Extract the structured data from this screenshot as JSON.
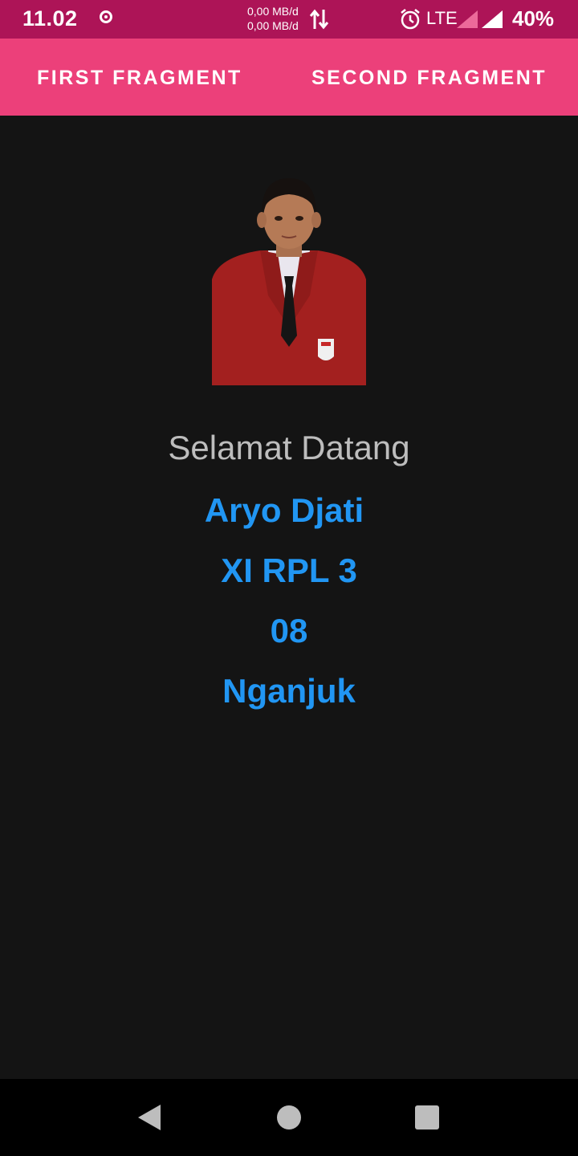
{
  "status_bar": {
    "time": "11.02",
    "net_up": "0,00 MB/d",
    "net_down": "0,00 MB/d",
    "network_type": "LTE",
    "battery": "40%",
    "icons": [
      "record-icon",
      "data-transfer-icon",
      "alarm-icon",
      "signal-icon",
      "signal-icon"
    ]
  },
  "tabs": [
    {
      "label": "FIRST FRAGMENT"
    },
    {
      "label": "SECOND FRAGMENT"
    }
  ],
  "profile": {
    "greeting": "Selamat Datang",
    "name": "Aryo Djati",
    "class": "XI RPL 3",
    "number": "08",
    "city": "Nganjuk"
  },
  "colors": {
    "status_bar": "#ad1457",
    "tab_bar": "#ec407a",
    "background": "#141414",
    "accent_text": "#2196f3",
    "greeting_text": "#bdbdbd"
  },
  "nav_bar": {
    "buttons": [
      "back-icon",
      "home-icon",
      "recents-icon"
    ]
  }
}
